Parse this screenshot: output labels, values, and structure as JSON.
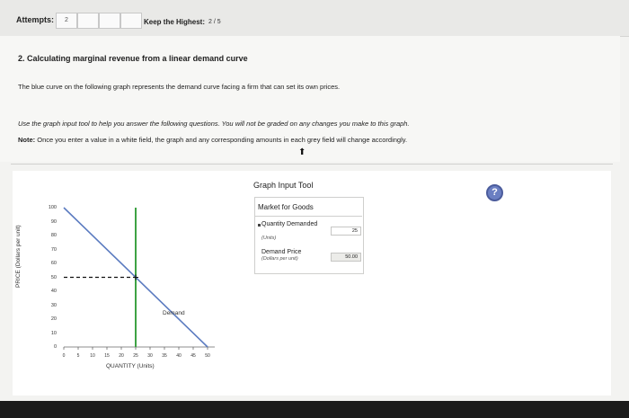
{
  "header": {
    "attempts_label": "Attempts:",
    "attempt_boxes": [
      "2",
      "",
      "",
      ""
    ],
    "keep_highest_label": "Keep the Highest:",
    "keep_highest_value": "2 / 5"
  },
  "question": {
    "title": "2. Calculating marginal revenue from a linear demand curve",
    "line1": "The blue curve on the following graph represents the demand curve facing a firm that can set its own prices.",
    "line2": "Use the graph input tool to help you answer the following questions. You will not be graded on any changes you make to this graph.",
    "note_label": "Note:",
    "note_text": " Once you enter a value in a white field, the graph and any corresponding amounts in each grey field will change accordingly."
  },
  "graph": {
    "y_label": "PRICE (Dollars per unit)",
    "x_label": "QUANTITY (Units)",
    "demand_label": "Demand",
    "y_ticks": [
      "100",
      "90",
      "80",
      "70",
      "60",
      "50",
      "40",
      "30",
      "20",
      "10",
      "0"
    ],
    "x_ticks": [
      "0",
      "5",
      "10",
      "15",
      "20",
      "25",
      "30",
      "35",
      "40",
      "45",
      "50"
    ]
  },
  "chart_data": {
    "type": "line",
    "xlabel": "QUANTITY (Units)",
    "ylabel": "PRICE (Dollars per unit)",
    "xlim": [
      0,
      50
    ],
    "ylim": [
      0,
      100
    ],
    "series": [
      {
        "name": "Demand",
        "x": [
          0,
          50
        ],
        "y": [
          100,
          0
        ],
        "color": "#5b7bc0"
      }
    ],
    "vertical_line": {
      "x": 25,
      "color": "#3ea344"
    },
    "dashed_price_line": {
      "y": 50,
      "x_to": 25
    },
    "point": {
      "x": 25,
      "y": 50
    }
  },
  "tool": {
    "title": "Graph Input Tool",
    "header": "Market for Goods",
    "qd_name": "Quantity Demanded",
    "qd_unit": "(Units)",
    "qd_value": "25",
    "dp_name": "Demand Price",
    "dp_unit": "(Dollars per unit)",
    "dp_value": "50.00"
  },
  "help": {
    "icon_text": "?"
  },
  "colors": {
    "demand": "#5b7bc0",
    "quantity_line": "#3ea344",
    "help": "#6b7fc2"
  }
}
